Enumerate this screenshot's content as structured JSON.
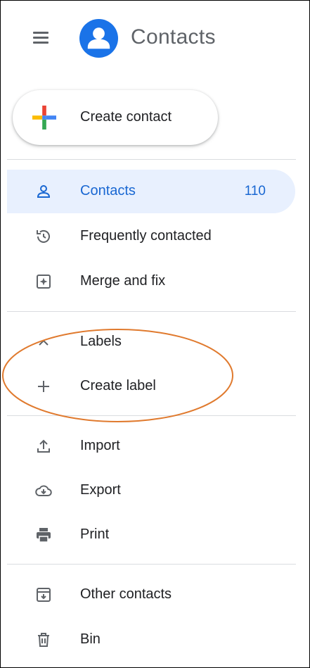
{
  "app": {
    "title": "Contacts"
  },
  "create_contact": {
    "label": "Create contact"
  },
  "nav": {
    "contacts": {
      "label": "Contacts",
      "count": "110"
    },
    "frequent": {
      "label": "Frequently contacted"
    },
    "merge": {
      "label": "Merge and fix"
    }
  },
  "labels": {
    "header": "Labels",
    "create": "Create label"
  },
  "tools": {
    "import": "Import",
    "export": "Export",
    "print": "Print"
  },
  "bottom": {
    "other": "Other contacts",
    "bin": "Bin"
  },
  "colors": {
    "accent": "#1a73e8",
    "active_bg": "#e8f0fe",
    "annotation": "#e07a2e"
  }
}
